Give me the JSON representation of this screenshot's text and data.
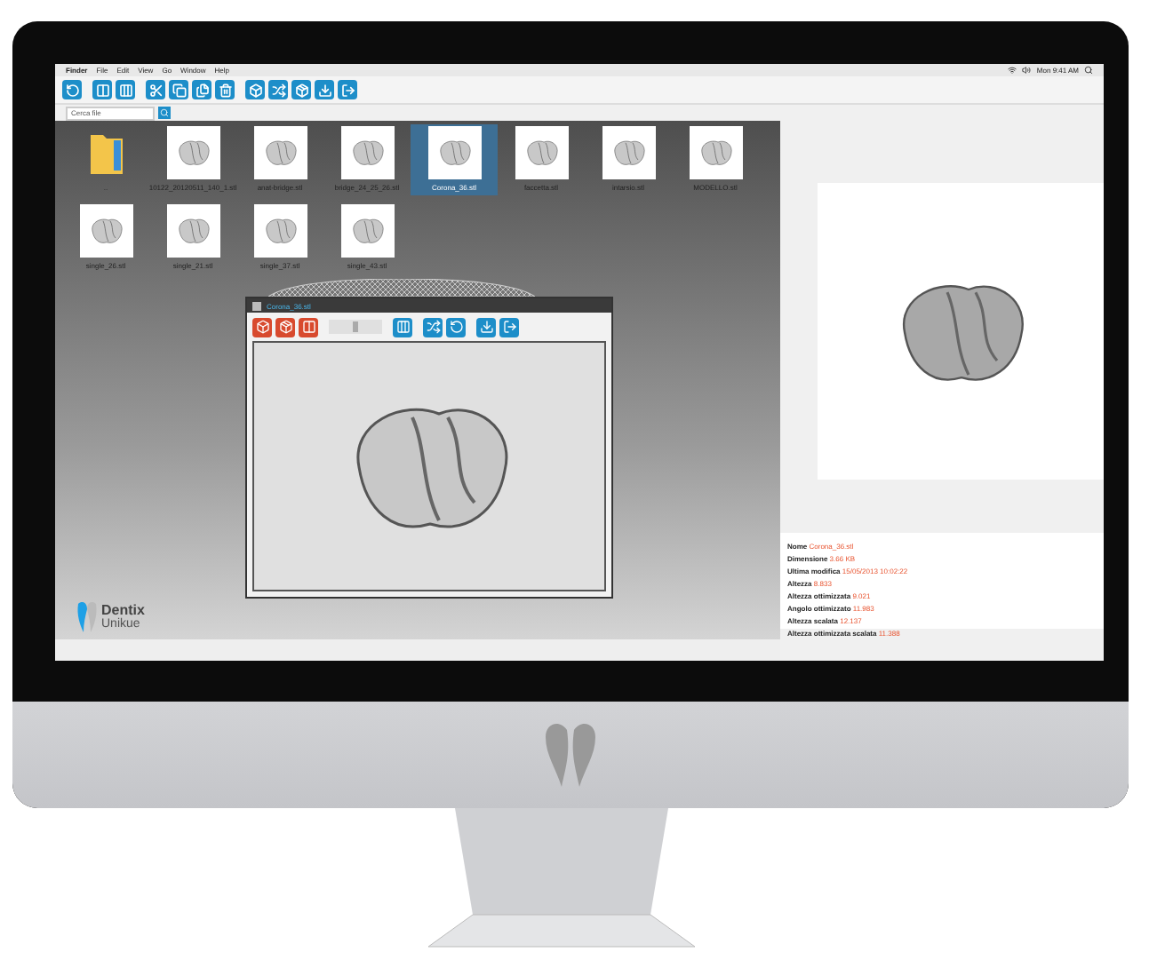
{
  "menu_bar": {
    "items": [
      "Finder",
      "File",
      "Edit",
      "View",
      "Go",
      "Window",
      "Help"
    ],
    "clock": "Mon 9:41 AM"
  },
  "search": {
    "placeholder": "Cerca file"
  },
  "files": [
    {
      "name": "..",
      "kind": "folder",
      "selected": false
    },
    {
      "name": "10122_20120511_140_1.stl",
      "kind": "model",
      "selected": false
    },
    {
      "name": "anat-bridge.stl",
      "kind": "model",
      "selected": false
    },
    {
      "name": "bridge_24_25_26.stl",
      "kind": "model",
      "selected": false
    },
    {
      "name": "Corona_36.stl",
      "kind": "model",
      "selected": true
    },
    {
      "name": "faccetta.stl",
      "kind": "model",
      "selected": false
    },
    {
      "name": "intarsio.stl",
      "kind": "model",
      "selected": false
    },
    {
      "name": "MODELLO.stl",
      "kind": "model",
      "selected": false
    },
    {
      "name": "single_26.stl",
      "kind": "model",
      "selected": false
    },
    {
      "name": "single_21.stl",
      "kind": "model",
      "selected": false
    },
    {
      "name": "single_37.stl",
      "kind": "model",
      "selected": false
    },
    {
      "name": "single_43.stl",
      "kind": "model",
      "selected": false
    }
  ],
  "viewer_window": {
    "title": "Corona_36.stl",
    "zoom": {
      "level": 0.5
    }
  },
  "logo": {
    "name": "Dentix",
    "tagline": "Unikue"
  },
  "details": [
    {
      "label": "Nome",
      "value": "Corona_36.stl"
    },
    {
      "label": "Dimensione",
      "value": "3.66 KB"
    },
    {
      "label": "Ultima modifica",
      "value": "15/05/2013 10:02:22"
    },
    {
      "label": "Altezza",
      "value": "8.833"
    },
    {
      "label": "Altezza ottimizzata",
      "value": "9.021"
    },
    {
      "label": "Angolo ottimizzato",
      "value": "11.983"
    },
    {
      "label": "Altezza scalata",
      "value": "12.137"
    },
    {
      "label": "Altezza ottimizzata scalata",
      "value": "11.388"
    }
  ]
}
